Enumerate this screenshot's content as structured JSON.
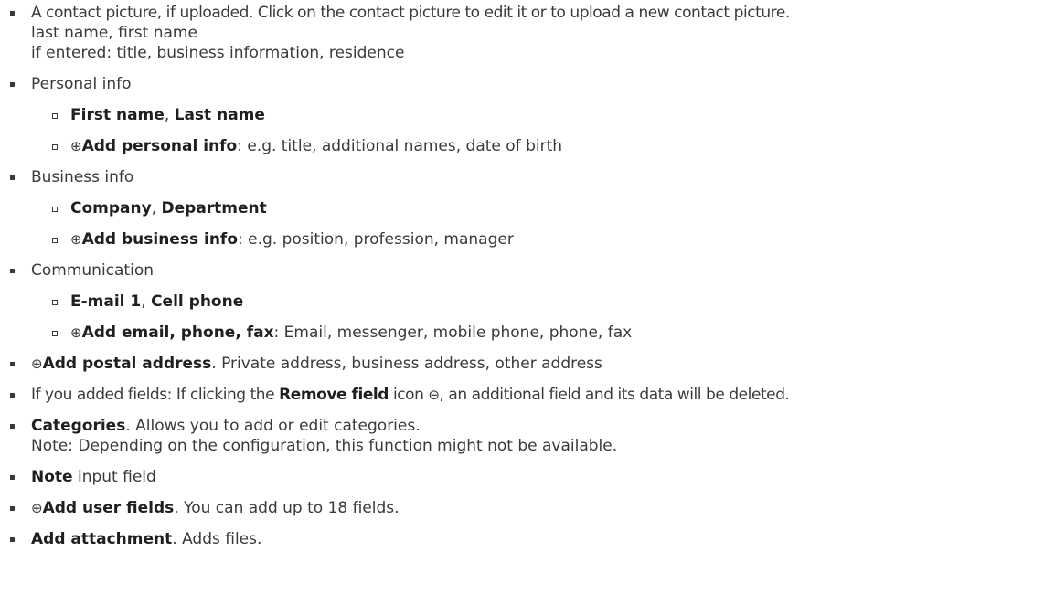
{
  "items": {
    "contact": {
      "line1": "A contact picture, if uploaded. Click on the contact picture to edit it or to upload a new contact picture.",
      "line2": "last name, first name",
      "line3": "if entered: title, business information, residence"
    },
    "personal": {
      "label": "Personal info",
      "sub1": {
        "b1": "First name",
        "sep": ", ",
        "b2": "Last name"
      },
      "sub2": {
        "icon": "⊕",
        "b": "Add personal info",
        "text": ": e.g. title, additional names, date of birth"
      }
    },
    "business": {
      "label": "Business info",
      "sub1": {
        "b1": "Company",
        "sep": ", ",
        "b2": "Department"
      },
      "sub2": {
        "icon": "⊕",
        "b": "Add business info",
        "text": ": e.g. position, profession, manager"
      }
    },
    "communication": {
      "label": "Communication",
      "sub1": {
        "b1": "E-mail 1",
        "sep": ", ",
        "b2": "Cell phone"
      },
      "sub2": {
        "icon": "⊕",
        "b": "Add email, phone, fax",
        "text": ": Email, messenger, mobile phone, phone, fax"
      }
    },
    "postal": {
      "icon": "⊕",
      "b": "Add postal address",
      "text": ". Private address, business address, other address"
    },
    "remove": {
      "pre": "If you added fields: If clicking the ",
      "b": "Remove field",
      "mid": " icon ",
      "icon": "⊖",
      "post": ", an additional field and its data will be deleted."
    },
    "categories": {
      "b": "Categories",
      "text": ". Allows you to add or edit categories.",
      "note": "Note: Depending on the configuration, this function might not be available."
    },
    "note": {
      "b": "Note",
      "text": " input field"
    },
    "userfields": {
      "icon": "⊕",
      "b": "Add user fields",
      "text": ". You can add up to 18 fields."
    },
    "attachment": {
      "b": "Add attachment",
      "text": ". Adds files."
    }
  }
}
